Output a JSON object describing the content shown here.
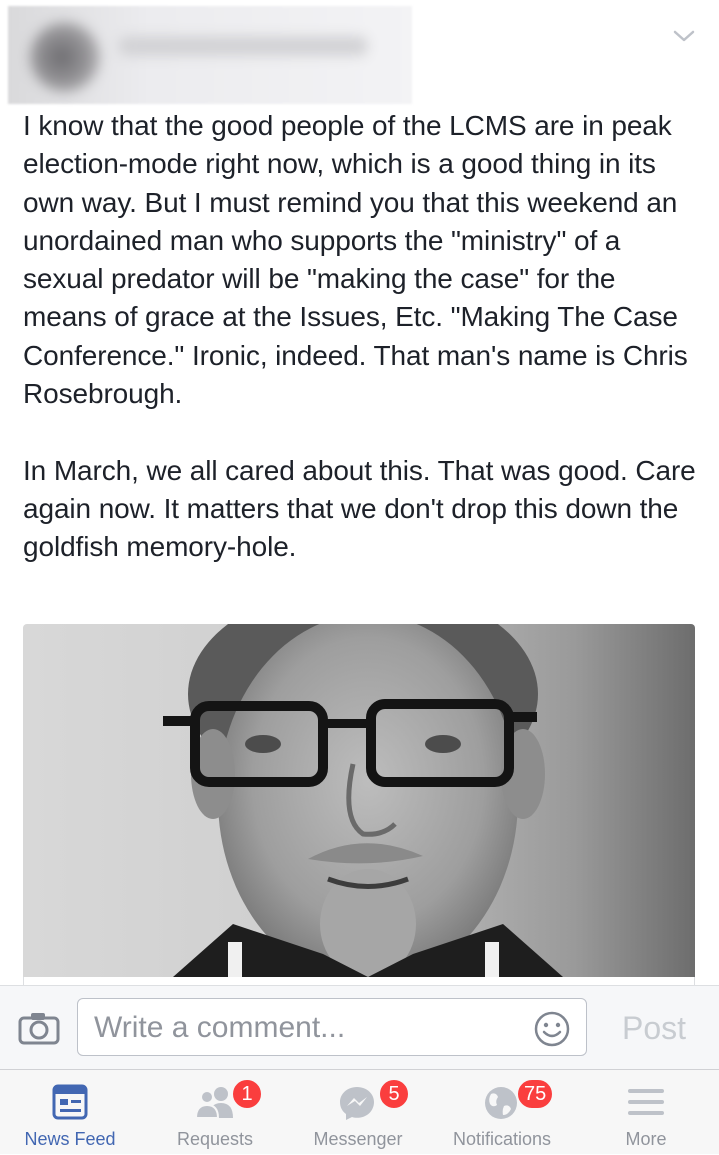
{
  "post": {
    "paragraphs": [
      "I know that the good people of the LCMS are in peak election-mode right now, which is a good thing in its own way. But I must remind you that this weekend an unordained man who supports the \"ministry\" of a sexual predator will be \"making the case\" for the means of grace at the Issues, Etc. \"Making The Case Conference.\" Ironic, indeed. That man's name is Chris Rosebrough.",
      "In March, we all cared about this. That was good. Care again now. It matters that we don't drop this down the goldfish memory-hole."
    ]
  },
  "comment_bar": {
    "placeholder": "Write a comment...",
    "post_label": "Post"
  },
  "tabs": [
    {
      "label": "News Feed",
      "icon": "news-feed-icon",
      "active": true
    },
    {
      "label": "Requests",
      "icon": "friends-icon",
      "badge": "1"
    },
    {
      "label": "Messenger",
      "icon": "messenger-icon",
      "badge": "5"
    },
    {
      "label": "Notifications",
      "icon": "globe-icon",
      "badge": "75"
    },
    {
      "label": "More",
      "icon": "menu-icon"
    }
  ],
  "colors": {
    "accent": "#4267b2",
    "badge": "#fa3e3e",
    "text": "#1d2129",
    "muted": "#90949c"
  }
}
